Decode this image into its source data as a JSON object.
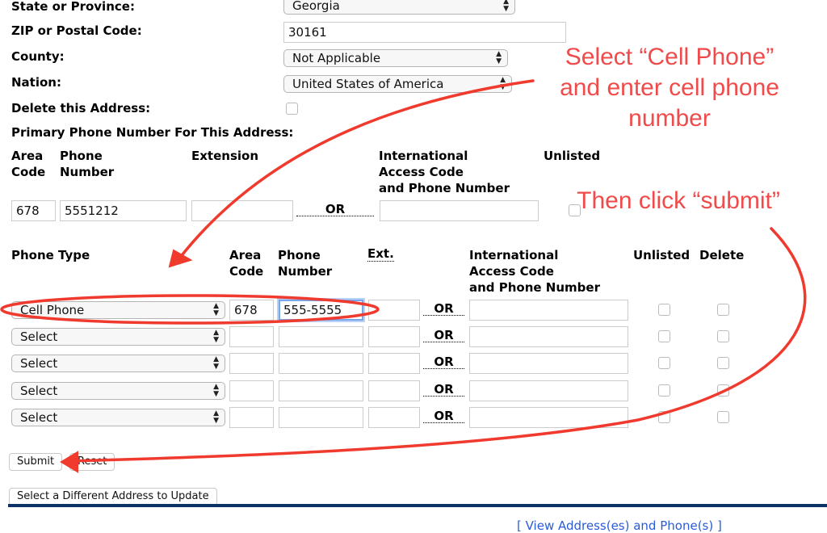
{
  "address": {
    "state_label": "State or Province:",
    "state_value": "Georgia",
    "zip_label": "ZIP or Postal Code:",
    "zip_value": "30161",
    "county_label": "County:",
    "county_value": "Not Applicable",
    "nation_label": "Nation:",
    "nation_value": "United States of America",
    "delete_label": "Delete this Address:",
    "delete_checked": false
  },
  "primary_phone": {
    "title": "Primary Phone Number For This Address:",
    "headers": {
      "area_code": "Area\nCode",
      "phone_number": "Phone\nNumber",
      "extension": "Extension",
      "international": "International\nAccess Code\nand Phone Number",
      "unlisted": "Unlisted"
    },
    "area_code": "678",
    "phone_number": "5551212",
    "extension": "",
    "or_label": "OR",
    "international": "",
    "unlisted": false
  },
  "additional_phones": {
    "headers": {
      "phone_type": "Phone Type",
      "area_code": "Area\nCode",
      "phone_number": "Phone\nNumber",
      "ext": "Ext.",
      "international": "International\nAccess Code\nand Phone Number",
      "unlisted": "Unlisted",
      "delete": "Delete"
    },
    "or_label": "OR",
    "rows": [
      {
        "type": "Cell Phone",
        "area_code": "678",
        "phone_number": "555-5555",
        "ext": "",
        "international": "",
        "unlisted": false,
        "delete": false
      },
      {
        "type": "Select",
        "area_code": "",
        "phone_number": "",
        "ext": "",
        "international": "",
        "unlisted": false,
        "delete": false
      },
      {
        "type": "Select",
        "area_code": "",
        "phone_number": "",
        "ext": "",
        "international": "",
        "unlisted": false,
        "delete": false
      },
      {
        "type": "Select",
        "area_code": "",
        "phone_number": "",
        "ext": "",
        "international": "",
        "unlisted": false,
        "delete": false
      },
      {
        "type": "Select",
        "area_code": "",
        "phone_number": "",
        "ext": "",
        "international": "",
        "unlisted": false,
        "delete": false
      }
    ]
  },
  "buttons": {
    "submit": "Submit",
    "reset": "Reset",
    "different_address": "Select a Different Address to Update"
  },
  "footer": {
    "link_text": "[ View Address(es) and Phone(s) ]"
  },
  "annotations": {
    "note_1": "Select “Cell Phone”\nand enter cell phone\nnumber",
    "note_2": "Then click “submit”",
    "color": "#f04a4a"
  }
}
